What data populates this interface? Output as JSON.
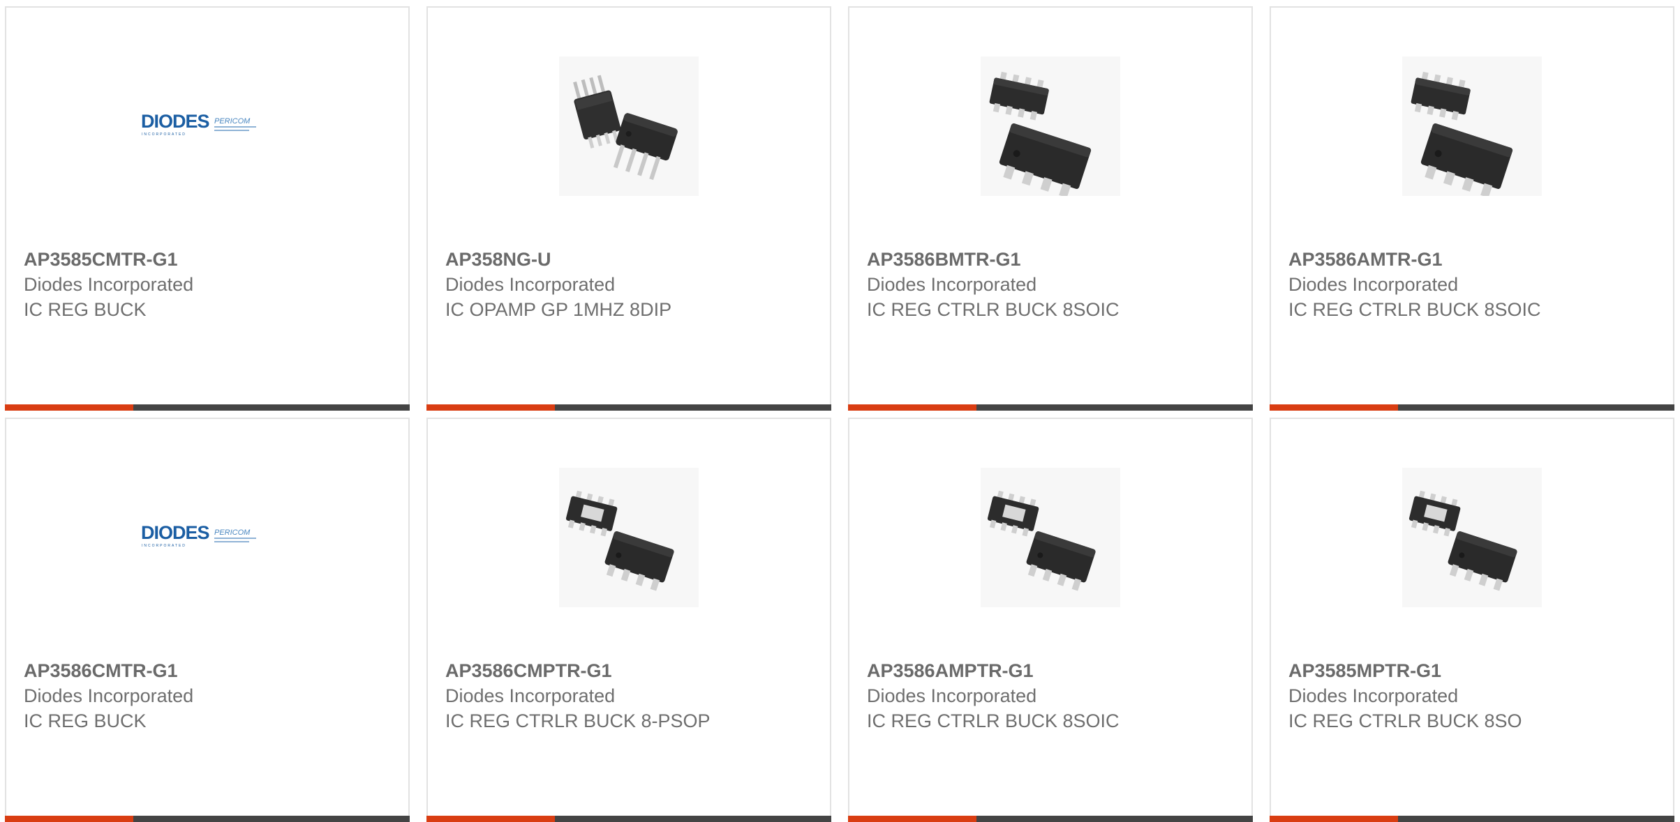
{
  "colors": {
    "accent": "#d93d12",
    "bar": "#444444",
    "border": "#e2e2e2",
    "text": "#6e6e6e",
    "diodes_blue": "#1b5ea3"
  },
  "products": [
    {
      "part_number": "AP3585CMTR-G1",
      "manufacturer": "Diodes Incorporated",
      "description": "IC REG BUCK",
      "image": "diodes-logo"
    },
    {
      "part_number": "AP358NG-U",
      "manufacturer": "Diodes Incorporated",
      "description": "IC OPAMP GP 1MHZ 8DIP",
      "image": "dip-chip"
    },
    {
      "part_number": "AP3586BMTR-G1",
      "manufacturer": "Diodes Incorporated",
      "description": "IC REG CTRLR BUCK 8SOIC",
      "image": "soic-chip"
    },
    {
      "part_number": "AP3586AMTR-G1",
      "manufacturer": "Diodes Incorporated",
      "description": "IC REG CTRLR BUCK 8SOIC",
      "image": "soic-chip"
    },
    {
      "part_number": "AP3586CMTR-G1",
      "manufacturer": "Diodes Incorporated",
      "description": "IC REG BUCK",
      "image": "diodes-logo"
    },
    {
      "part_number": "AP3586CMPTR-G1",
      "manufacturer": "Diodes Incorporated",
      "description": "IC REG CTRLR BUCK 8-PSOP",
      "image": "psop-chip"
    },
    {
      "part_number": "AP3586AMPTR-G1",
      "manufacturer": "Diodes Incorporated",
      "description": "IC REG CTRLR BUCK 8SOIC",
      "image": "psop-chip"
    },
    {
      "part_number": "AP3585MPTR-G1",
      "manufacturer": "Diodes Incorporated",
      "description": "IC REG CTRLR BUCK 8SO",
      "image": "psop-chip"
    }
  ],
  "logo": {
    "brand": "DIODES",
    "tagline": "INCORPORATED",
    "partner": "PERICOM"
  }
}
